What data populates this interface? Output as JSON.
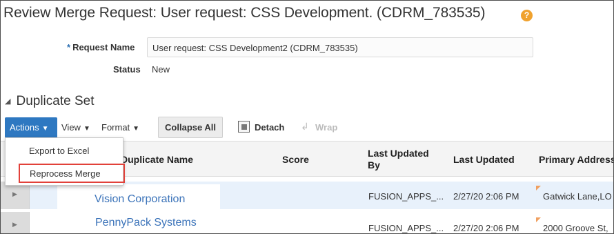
{
  "page": {
    "title": "Review Merge Request: User request: CSS Development. (CDRM_783535)",
    "help_icon": "help-icon"
  },
  "form": {
    "request_name_label": "Request Name",
    "required_marker": "*",
    "request_name_value": "User request: CSS Development2 (CDRM_783535)",
    "status_label": "Status",
    "status_value": "New"
  },
  "section": {
    "title": "Duplicate Set"
  },
  "toolbar": {
    "actions_label": "Actions",
    "view_label": "View",
    "format_label": "Format",
    "collapse_all_label": "Collapse All",
    "detach_label": "Detach",
    "wrap_label": "Wrap"
  },
  "actions_menu": {
    "items": [
      {
        "label": "Export to Excel"
      },
      {
        "label": "Reprocess Merge",
        "highlighted": true
      }
    ]
  },
  "table": {
    "columns": [
      "Duplicate Name",
      "Score",
      "Last Updated By",
      "Last Updated",
      "Primary Address"
    ],
    "rows": [
      {
        "duplicate_name": "Vision Corporation",
        "score": "",
        "last_updated_by": "FUSION_APPS_...",
        "last_updated": "2/27/20 2:06 PM",
        "primary_address": "Gatwick Lane,LO",
        "selected": true
      },
      {
        "duplicate_name": "PennyPack Systems",
        "score": "",
        "last_updated_by": "FUSION_APPS_...",
        "last_updated": "2/27/20 2:06 PM",
        "primary_address": "2000 Groove St,",
        "selected": false
      }
    ]
  },
  "colors": {
    "actions_button": "#2e78c1",
    "link": "#3b73b9",
    "help_icon": "#f0a22e",
    "highlight_border": "#e2413a",
    "selected_row": "#e8f1fb"
  }
}
